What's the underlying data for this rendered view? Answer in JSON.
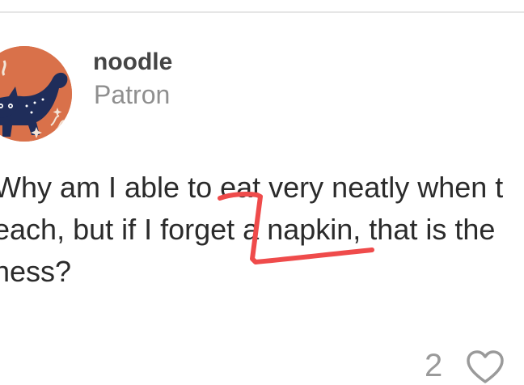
{
  "post": {
    "author": {
      "username": "noodle",
      "role": "Patron"
    },
    "body_lines": [
      "Why am I able to eat very neatly when t",
      "each, but if I forget a napkin, that is the",
      "ness?"
    ],
    "likes": {
      "count": "2",
      "icon": "heart-outline-icon"
    }
  },
  "colors": {
    "annotation": "#ef4b4b",
    "avatar_bg": "#d9714a",
    "avatar_figure": "#1f2d5a"
  }
}
